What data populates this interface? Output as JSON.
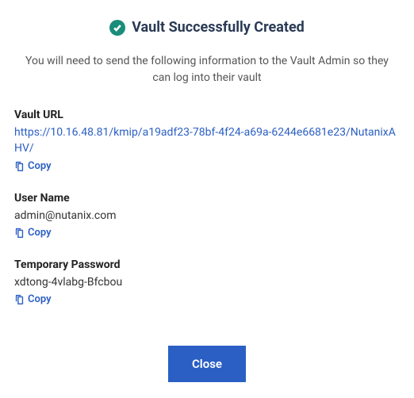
{
  "header": {
    "title": "Vault Successfully Created"
  },
  "instructions": "You will need to send the following information to the Vault Admin so they can log into their vault",
  "fields": {
    "vault_url": {
      "label": "Vault URL",
      "value": "https://10.16.48.81/kmip/a19adf23-78bf-4f24-a69a-6244e6681e23/NutanixAHV/",
      "copy_label": "Copy"
    },
    "user_name": {
      "label": "User Name",
      "value": "admin@nutanix.com",
      "copy_label": "Copy"
    },
    "temp_password": {
      "label": "Temporary Password",
      "value": "xdtong-4vlabg-Bfcbou",
      "copy_label": "Copy"
    }
  },
  "footer": {
    "close_label": "Close"
  },
  "colors": {
    "accent": "#2b5fc4",
    "success": "#1a8c7a"
  }
}
